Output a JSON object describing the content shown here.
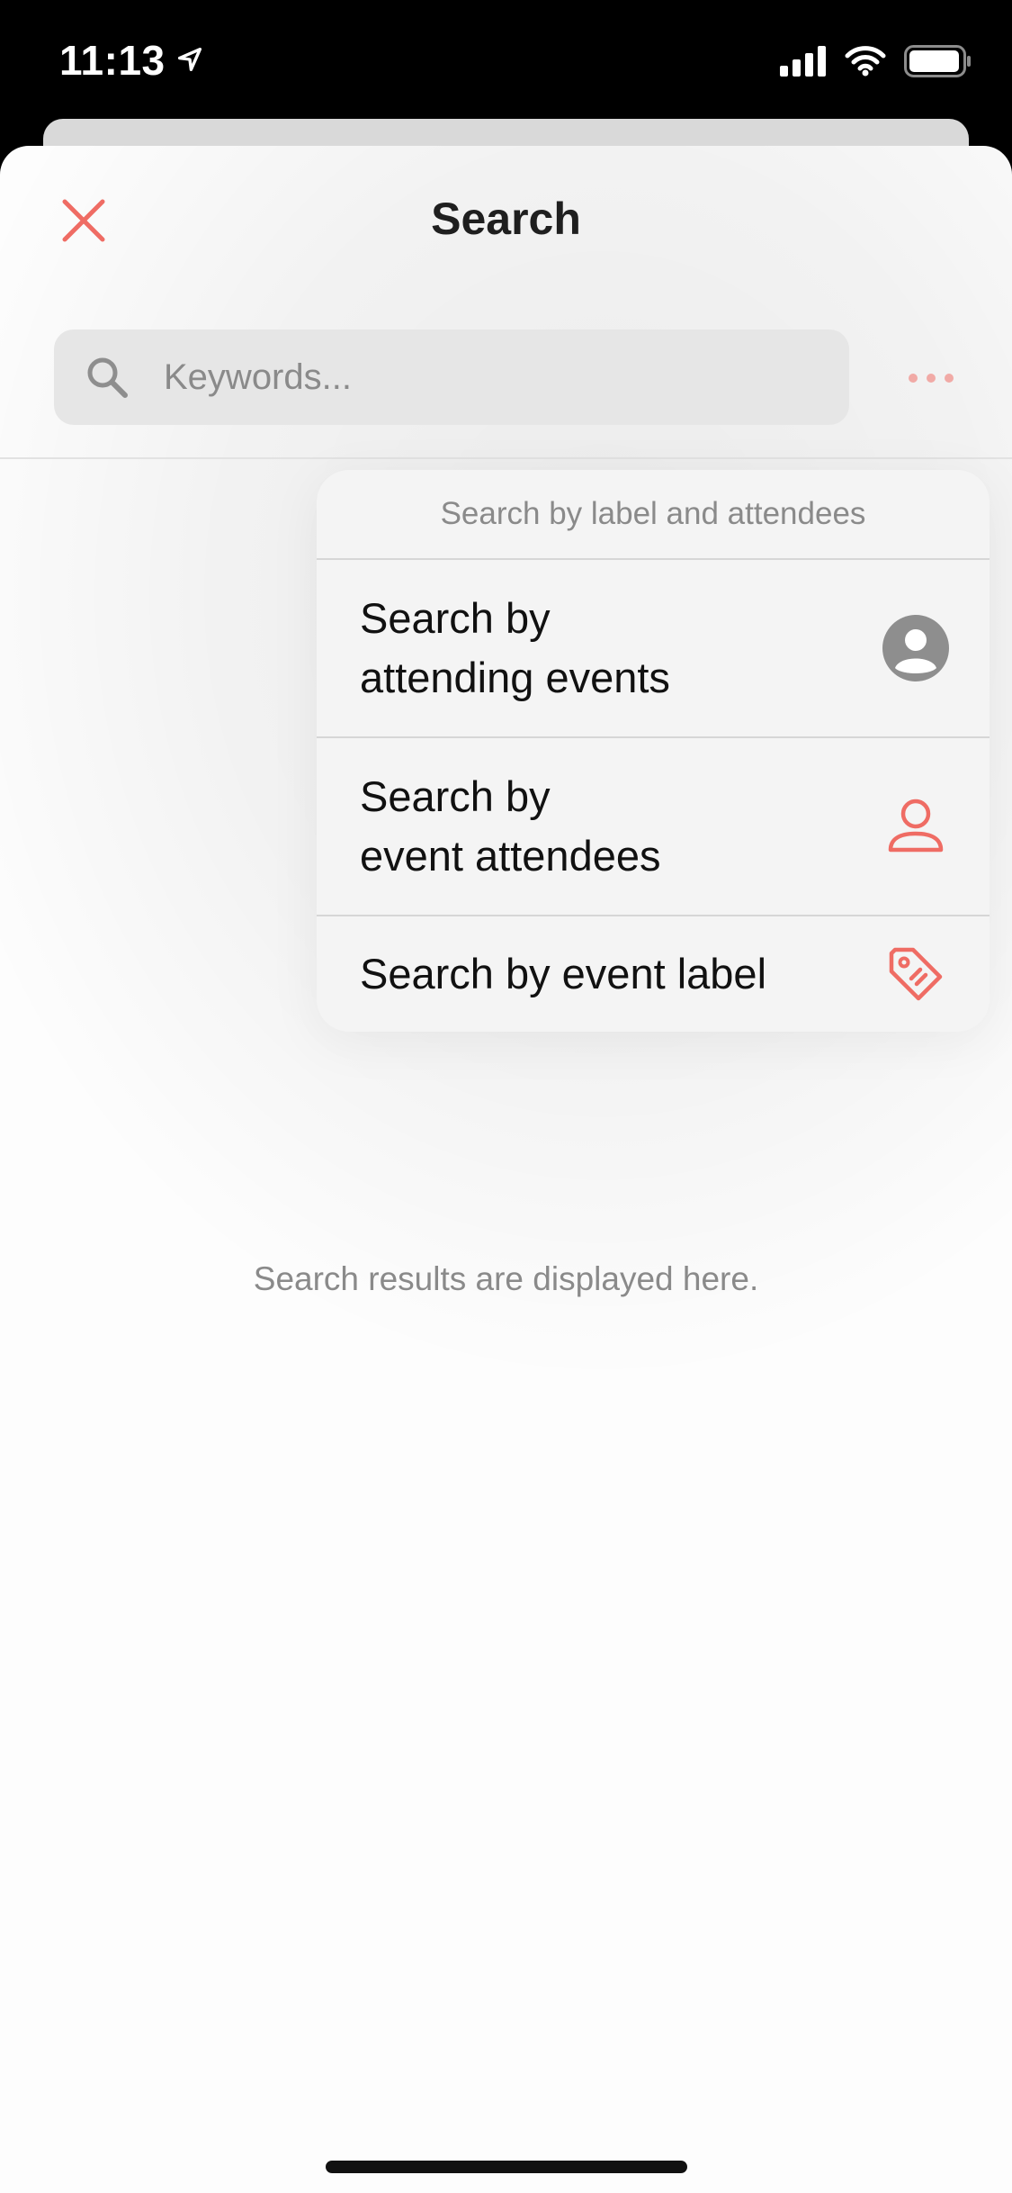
{
  "status_bar": {
    "time": "11:13",
    "location_icon": "location-arrow-icon",
    "signal_icon": "cellular-signal-icon",
    "wifi_icon": "wifi-icon",
    "battery_icon": "battery-icon"
  },
  "header": {
    "title": "Search",
    "close_icon": "close-icon"
  },
  "search": {
    "placeholder": "Keywords...",
    "value": "",
    "icon": "search-icon",
    "more_icon": "more-horizontal-icon"
  },
  "menu": {
    "header": "Search by label and attendees",
    "items": [
      {
        "label_line1": "Search by",
        "label_line2": "attending events",
        "icon": "person-circle-icon"
      },
      {
        "label_line1": "Search by",
        "label_line2": "event attendees",
        "icon": "person-outline-icon"
      },
      {
        "label": "Search by event label",
        "icon": "tag-icon"
      }
    ]
  },
  "results": {
    "empty_text": "Search results are displayed here."
  },
  "colors": {
    "accent": "#ef6c64",
    "accent_light": "#f1aaa6",
    "muted_text": "#8a8a8a",
    "icon_gray": "#8e8e8e"
  }
}
